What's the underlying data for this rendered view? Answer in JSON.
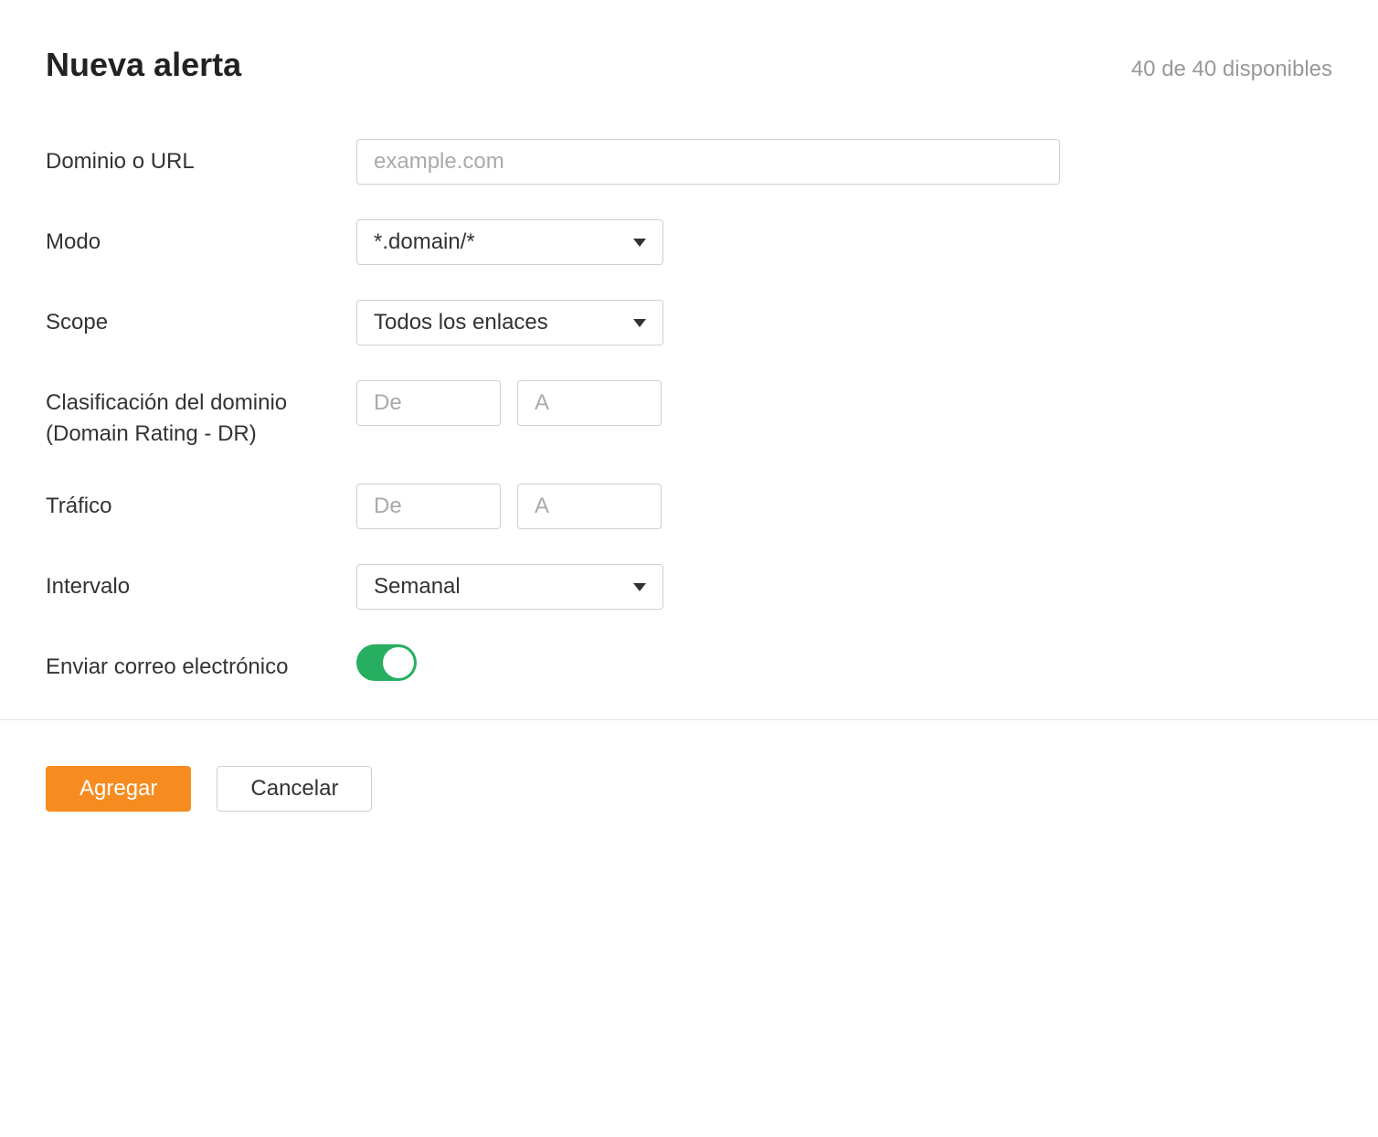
{
  "header": {
    "title": "Nueva alerta",
    "availability": "40 de 40 disponibles"
  },
  "form": {
    "domain": {
      "label": "Dominio o URL",
      "placeholder": "example.com",
      "value": ""
    },
    "mode": {
      "label": "Modo",
      "selected": "*.domain/*"
    },
    "scope": {
      "label": "Scope",
      "selected": "Todos los enlaces"
    },
    "domain_rating": {
      "label": "Clasificación del dominio (Domain Rating - DR)",
      "from_placeholder": "De",
      "to_placeholder": "A",
      "from_value": "",
      "to_value": ""
    },
    "traffic": {
      "label": "Tráfico",
      "from_placeholder": "De",
      "to_placeholder": "A",
      "from_value": "",
      "to_value": ""
    },
    "interval": {
      "label": "Intervalo",
      "selected": "Semanal"
    },
    "send_email": {
      "label": "Enviar correo electrónico",
      "enabled": true
    }
  },
  "actions": {
    "add": "Agregar",
    "cancel": "Cancelar"
  },
  "colors": {
    "primary": "#f68c1f",
    "toggle_on": "#27ae60"
  }
}
